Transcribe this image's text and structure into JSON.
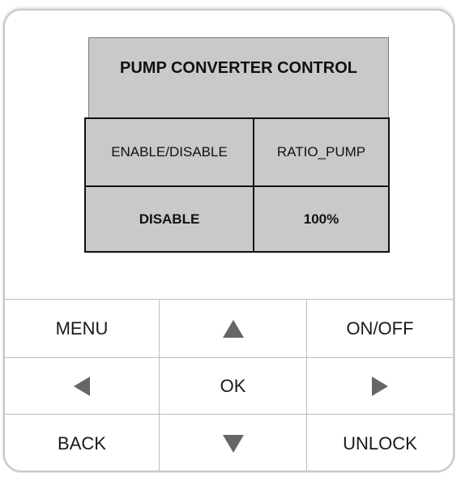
{
  "screen": {
    "title": "PUMP CONVERTER CONTROL",
    "headers": [
      "ENABLE/DISABLE",
      "RATIO_PUMP"
    ],
    "values": [
      "DISABLE",
      "100%"
    ]
  },
  "keypad": {
    "menu_label": "MENU",
    "on_off_label": "ON/OFF",
    "ok_label": "OK",
    "back_label": "BACK",
    "unlock_label": "UNLOCK",
    "up_icon": "triangle-up-icon",
    "down_icon": "triangle-down-icon",
    "left_icon": "triangle-left-icon",
    "right_icon": "triangle-right-icon"
  },
  "colors": {
    "screen_background": "#c9c9c9",
    "arrow_color": "#666666"
  }
}
